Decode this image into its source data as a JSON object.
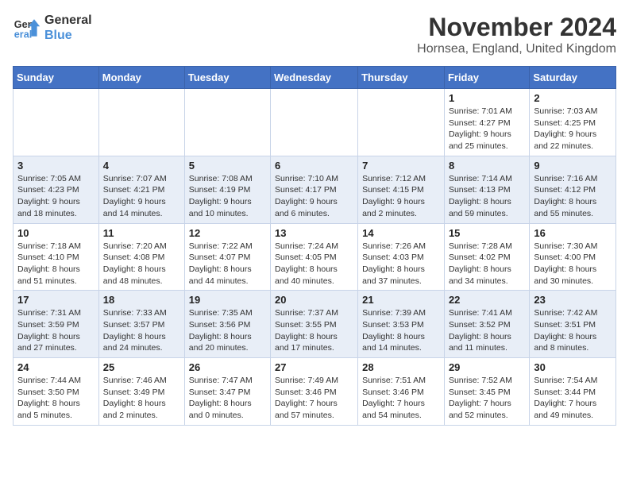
{
  "logo": {
    "line1": "General",
    "line2": "Blue"
  },
  "title": "November 2024",
  "subtitle": "Hornsea, England, United Kingdom",
  "headers": [
    "Sunday",
    "Monday",
    "Tuesday",
    "Wednesday",
    "Thursday",
    "Friday",
    "Saturday"
  ],
  "weeks": [
    [
      {
        "day": "",
        "info": ""
      },
      {
        "day": "",
        "info": ""
      },
      {
        "day": "",
        "info": ""
      },
      {
        "day": "",
        "info": ""
      },
      {
        "day": "",
        "info": ""
      },
      {
        "day": "1",
        "info": "Sunrise: 7:01 AM\nSunset: 4:27 PM\nDaylight: 9 hours and 25 minutes."
      },
      {
        "day": "2",
        "info": "Sunrise: 7:03 AM\nSunset: 4:25 PM\nDaylight: 9 hours and 22 minutes."
      }
    ],
    [
      {
        "day": "3",
        "info": "Sunrise: 7:05 AM\nSunset: 4:23 PM\nDaylight: 9 hours and 18 minutes."
      },
      {
        "day": "4",
        "info": "Sunrise: 7:07 AM\nSunset: 4:21 PM\nDaylight: 9 hours and 14 minutes."
      },
      {
        "day": "5",
        "info": "Sunrise: 7:08 AM\nSunset: 4:19 PM\nDaylight: 9 hours and 10 minutes."
      },
      {
        "day": "6",
        "info": "Sunrise: 7:10 AM\nSunset: 4:17 PM\nDaylight: 9 hours and 6 minutes."
      },
      {
        "day": "7",
        "info": "Sunrise: 7:12 AM\nSunset: 4:15 PM\nDaylight: 9 hours and 2 minutes."
      },
      {
        "day": "8",
        "info": "Sunrise: 7:14 AM\nSunset: 4:13 PM\nDaylight: 8 hours and 59 minutes."
      },
      {
        "day": "9",
        "info": "Sunrise: 7:16 AM\nSunset: 4:12 PM\nDaylight: 8 hours and 55 minutes."
      }
    ],
    [
      {
        "day": "10",
        "info": "Sunrise: 7:18 AM\nSunset: 4:10 PM\nDaylight: 8 hours and 51 minutes."
      },
      {
        "day": "11",
        "info": "Sunrise: 7:20 AM\nSunset: 4:08 PM\nDaylight: 8 hours and 48 minutes."
      },
      {
        "day": "12",
        "info": "Sunrise: 7:22 AM\nSunset: 4:07 PM\nDaylight: 8 hours and 44 minutes."
      },
      {
        "day": "13",
        "info": "Sunrise: 7:24 AM\nSunset: 4:05 PM\nDaylight: 8 hours and 40 minutes."
      },
      {
        "day": "14",
        "info": "Sunrise: 7:26 AM\nSunset: 4:03 PM\nDaylight: 8 hours and 37 minutes."
      },
      {
        "day": "15",
        "info": "Sunrise: 7:28 AM\nSunset: 4:02 PM\nDaylight: 8 hours and 34 minutes."
      },
      {
        "day": "16",
        "info": "Sunrise: 7:30 AM\nSunset: 4:00 PM\nDaylight: 8 hours and 30 minutes."
      }
    ],
    [
      {
        "day": "17",
        "info": "Sunrise: 7:31 AM\nSunset: 3:59 PM\nDaylight: 8 hours and 27 minutes."
      },
      {
        "day": "18",
        "info": "Sunrise: 7:33 AM\nSunset: 3:57 PM\nDaylight: 8 hours and 24 minutes."
      },
      {
        "day": "19",
        "info": "Sunrise: 7:35 AM\nSunset: 3:56 PM\nDaylight: 8 hours and 20 minutes."
      },
      {
        "day": "20",
        "info": "Sunrise: 7:37 AM\nSunset: 3:55 PM\nDaylight: 8 hours and 17 minutes."
      },
      {
        "day": "21",
        "info": "Sunrise: 7:39 AM\nSunset: 3:53 PM\nDaylight: 8 hours and 14 minutes."
      },
      {
        "day": "22",
        "info": "Sunrise: 7:41 AM\nSunset: 3:52 PM\nDaylight: 8 hours and 11 minutes."
      },
      {
        "day": "23",
        "info": "Sunrise: 7:42 AM\nSunset: 3:51 PM\nDaylight: 8 hours and 8 minutes."
      }
    ],
    [
      {
        "day": "24",
        "info": "Sunrise: 7:44 AM\nSunset: 3:50 PM\nDaylight: 8 hours and 5 minutes."
      },
      {
        "day": "25",
        "info": "Sunrise: 7:46 AM\nSunset: 3:49 PM\nDaylight: 8 hours and 2 minutes."
      },
      {
        "day": "26",
        "info": "Sunrise: 7:47 AM\nSunset: 3:47 PM\nDaylight: 8 hours and 0 minutes."
      },
      {
        "day": "27",
        "info": "Sunrise: 7:49 AM\nSunset: 3:46 PM\nDaylight: 7 hours and 57 minutes."
      },
      {
        "day": "28",
        "info": "Sunrise: 7:51 AM\nSunset: 3:46 PM\nDaylight: 7 hours and 54 minutes."
      },
      {
        "day": "29",
        "info": "Sunrise: 7:52 AM\nSunset: 3:45 PM\nDaylight: 7 hours and 52 minutes."
      },
      {
        "day": "30",
        "info": "Sunrise: 7:54 AM\nSunset: 3:44 PM\nDaylight: 7 hours and 49 minutes."
      }
    ]
  ]
}
